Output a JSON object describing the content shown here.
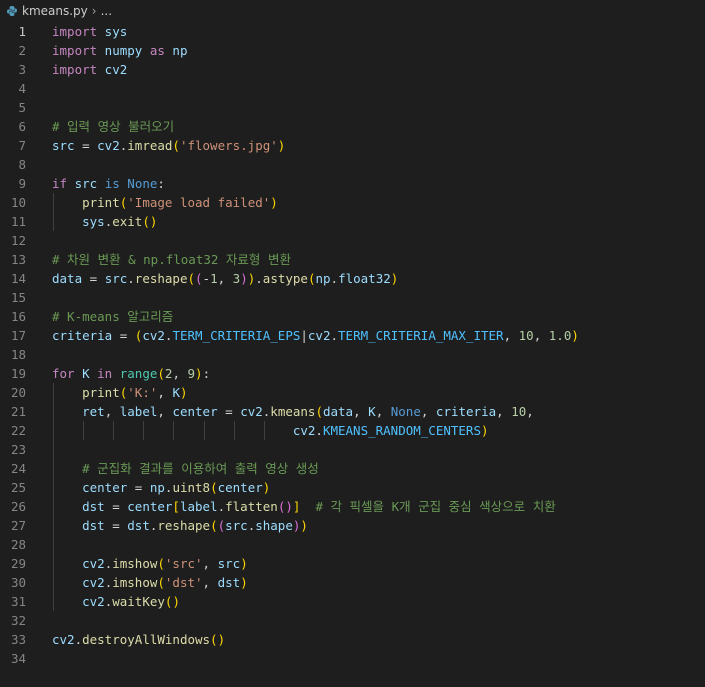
{
  "breadcrumb": {
    "file": "kmeans.py",
    "ellipsis": "..."
  },
  "editor": {
    "active_line": 1,
    "lines": [
      {
        "num": "1",
        "indent": [],
        "tokens": [
          {
            "t": "import",
            "c": "kw"
          },
          {
            "t": " sys",
            "c": "var"
          }
        ]
      },
      {
        "num": "2",
        "indent": [],
        "tokens": [
          {
            "t": "import",
            "c": "kw"
          },
          {
            "t": " numpy ",
            "c": "var"
          },
          {
            "t": "as",
            "c": "kw"
          },
          {
            "t": " np",
            "c": "var"
          }
        ]
      },
      {
        "num": "3",
        "indent": [],
        "tokens": [
          {
            "t": "import",
            "c": "kw"
          },
          {
            "t": " cv2",
            "c": "var"
          }
        ]
      },
      {
        "num": "4",
        "indent": [],
        "tokens": []
      },
      {
        "num": "5",
        "indent": [],
        "tokens": []
      },
      {
        "num": "6",
        "indent": [],
        "tokens": [
          {
            "t": "# 입력 영상 불러오기",
            "c": "cmt"
          }
        ]
      },
      {
        "num": "7",
        "indent": [],
        "tokens": [
          {
            "t": "src",
            "c": "var"
          },
          {
            "t": " = ",
            "c": "op"
          },
          {
            "t": "cv2",
            "c": "var"
          },
          {
            "t": ".",
            "c": "op"
          },
          {
            "t": "imread",
            "c": "fn"
          },
          {
            "t": "(",
            "c": "b1"
          },
          {
            "t": "'flowers.jpg'",
            "c": "str"
          },
          {
            "t": ")",
            "c": "b1"
          }
        ]
      },
      {
        "num": "8",
        "indent": [],
        "tokens": []
      },
      {
        "num": "9",
        "indent": [],
        "tokens": [
          {
            "t": "if",
            "c": "kw"
          },
          {
            "t": " src ",
            "c": "var"
          },
          {
            "t": "is",
            "c": "blue"
          },
          {
            "t": " ",
            "c": "op"
          },
          {
            "t": "None",
            "c": "blue"
          },
          {
            "t": ":",
            "c": "op"
          }
        ]
      },
      {
        "num": "10",
        "indent": [
          1
        ],
        "tokens": [
          {
            "t": "    ",
            "c": "op"
          },
          {
            "t": "print",
            "c": "fn"
          },
          {
            "t": "(",
            "c": "b1"
          },
          {
            "t": "'Image load failed'",
            "c": "str"
          },
          {
            "t": ")",
            "c": "b1"
          }
        ]
      },
      {
        "num": "11",
        "indent": [
          1
        ],
        "tokens": [
          {
            "t": "    ",
            "c": "op"
          },
          {
            "t": "sys",
            "c": "var"
          },
          {
            "t": ".",
            "c": "op"
          },
          {
            "t": "exit",
            "c": "fn"
          },
          {
            "t": "(",
            "c": "b1"
          },
          {
            "t": ")",
            "c": "b1"
          }
        ]
      },
      {
        "num": "12",
        "indent": [],
        "tokens": []
      },
      {
        "num": "13",
        "indent": [],
        "tokens": [
          {
            "t": "# 차원 변환 & np.float32 자료형 변환",
            "c": "cmt"
          }
        ]
      },
      {
        "num": "14",
        "indent": [],
        "tokens": [
          {
            "t": "data",
            "c": "var"
          },
          {
            "t": " = ",
            "c": "op"
          },
          {
            "t": "src",
            "c": "var"
          },
          {
            "t": ".",
            "c": "op"
          },
          {
            "t": "reshape",
            "c": "fn"
          },
          {
            "t": "(",
            "c": "b1"
          },
          {
            "t": "(",
            "c": "b2"
          },
          {
            "t": "-",
            "c": "op"
          },
          {
            "t": "1",
            "c": "num"
          },
          {
            "t": ", ",
            "c": "op"
          },
          {
            "t": "3",
            "c": "num"
          },
          {
            "t": ")",
            "c": "b2"
          },
          {
            "t": ")",
            "c": "b1"
          },
          {
            "t": ".",
            "c": "op"
          },
          {
            "t": "astype",
            "c": "fn"
          },
          {
            "t": "(",
            "c": "b1"
          },
          {
            "t": "np",
            "c": "var"
          },
          {
            "t": ".",
            "c": "op"
          },
          {
            "t": "float32",
            "c": "var"
          },
          {
            "t": ")",
            "c": "b1"
          }
        ]
      },
      {
        "num": "15",
        "indent": [],
        "tokens": []
      },
      {
        "num": "16",
        "indent": [],
        "tokens": [
          {
            "t": "# K-means 알고리즘",
            "c": "cmt"
          }
        ]
      },
      {
        "num": "17",
        "indent": [],
        "tokens": [
          {
            "t": "criteria",
            "c": "var"
          },
          {
            "t": " = ",
            "c": "op"
          },
          {
            "t": "(",
            "c": "b1"
          },
          {
            "t": "cv2",
            "c": "var"
          },
          {
            "t": ".",
            "c": "op"
          },
          {
            "t": "TERM_CRITERIA_EPS",
            "c": "const"
          },
          {
            "t": "|",
            "c": "op"
          },
          {
            "t": "cv2",
            "c": "var"
          },
          {
            "t": ".",
            "c": "op"
          },
          {
            "t": "TERM_CRITERIA_MAX_ITER",
            "c": "const"
          },
          {
            "t": ", ",
            "c": "op"
          },
          {
            "t": "10",
            "c": "num"
          },
          {
            "t": ", ",
            "c": "op"
          },
          {
            "t": "1.0",
            "c": "num"
          },
          {
            "t": ")",
            "c": "b1"
          }
        ]
      },
      {
        "num": "18",
        "indent": [],
        "tokens": []
      },
      {
        "num": "19",
        "indent": [],
        "tokens": [
          {
            "t": "for",
            "c": "kw"
          },
          {
            "t": " K ",
            "c": "var"
          },
          {
            "t": "in",
            "c": "kw"
          },
          {
            "t": " ",
            "c": "op"
          },
          {
            "t": "range",
            "c": "cls"
          },
          {
            "t": "(",
            "c": "b1"
          },
          {
            "t": "2",
            "c": "num"
          },
          {
            "t": ", ",
            "c": "op"
          },
          {
            "t": "9",
            "c": "num"
          },
          {
            "t": ")",
            "c": "b1"
          },
          {
            "t": ":",
            "c": "op"
          }
        ]
      },
      {
        "num": "20",
        "indent": [
          1
        ],
        "tokens": [
          {
            "t": "    ",
            "c": "op"
          },
          {
            "t": "print",
            "c": "fn"
          },
          {
            "t": "(",
            "c": "b1"
          },
          {
            "t": "'K:'",
            "c": "str"
          },
          {
            "t": ", ",
            "c": "op"
          },
          {
            "t": "K",
            "c": "var"
          },
          {
            "t": ")",
            "c": "b1"
          }
        ]
      },
      {
        "num": "21",
        "indent": [
          1
        ],
        "tokens": [
          {
            "t": "    ",
            "c": "op"
          },
          {
            "t": "ret",
            "c": "var"
          },
          {
            "t": ", ",
            "c": "op"
          },
          {
            "t": "label",
            "c": "var"
          },
          {
            "t": ", ",
            "c": "op"
          },
          {
            "t": "center",
            "c": "var"
          },
          {
            "t": " = ",
            "c": "op"
          },
          {
            "t": "cv2",
            "c": "var"
          },
          {
            "t": ".",
            "c": "op"
          },
          {
            "t": "kmeans",
            "c": "fn"
          },
          {
            "t": "(",
            "c": "b1"
          },
          {
            "t": "data",
            "c": "var"
          },
          {
            "t": ", ",
            "c": "op"
          },
          {
            "t": "K",
            "c": "var"
          },
          {
            "t": ", ",
            "c": "op"
          },
          {
            "t": "None",
            "c": "blue"
          },
          {
            "t": ", ",
            "c": "op"
          },
          {
            "t": "criteria",
            "c": "var"
          },
          {
            "t": ", ",
            "c": "op"
          },
          {
            "t": "10",
            "c": "num"
          },
          {
            "t": ",",
            "c": "op"
          }
        ]
      },
      {
        "num": "22",
        "indent": [
          1,
          2,
          3,
          4,
          5,
          6,
          7,
          8
        ],
        "tokens": [
          {
            "t": "                                ",
            "c": "op"
          },
          {
            "t": "cv2",
            "c": "var"
          },
          {
            "t": ".",
            "c": "op"
          },
          {
            "t": "KMEANS_RANDOM_CENTERS",
            "c": "const"
          },
          {
            "t": ")",
            "c": "b1"
          }
        ]
      },
      {
        "num": "23",
        "indent": [
          1
        ],
        "tokens": []
      },
      {
        "num": "24",
        "indent": [
          1
        ],
        "tokens": [
          {
            "t": "    ",
            "c": "op"
          },
          {
            "t": "# 군집화 결과를 이용하여 출력 영상 생성",
            "c": "cmt"
          }
        ]
      },
      {
        "num": "25",
        "indent": [
          1
        ],
        "tokens": [
          {
            "t": "    ",
            "c": "op"
          },
          {
            "t": "center",
            "c": "var"
          },
          {
            "t": " = ",
            "c": "op"
          },
          {
            "t": "np",
            "c": "var"
          },
          {
            "t": ".",
            "c": "op"
          },
          {
            "t": "uint8",
            "c": "fn"
          },
          {
            "t": "(",
            "c": "b1"
          },
          {
            "t": "center",
            "c": "var"
          },
          {
            "t": ")",
            "c": "b1"
          }
        ]
      },
      {
        "num": "26",
        "indent": [
          1
        ],
        "tokens": [
          {
            "t": "    ",
            "c": "op"
          },
          {
            "t": "dst",
            "c": "var"
          },
          {
            "t": " = ",
            "c": "op"
          },
          {
            "t": "center",
            "c": "var"
          },
          {
            "t": "[",
            "c": "b1"
          },
          {
            "t": "label",
            "c": "var"
          },
          {
            "t": ".",
            "c": "op"
          },
          {
            "t": "flatten",
            "c": "fn"
          },
          {
            "t": "(",
            "c": "b2"
          },
          {
            "t": ")",
            "c": "b2"
          },
          {
            "t": "]",
            "c": "b1"
          },
          {
            "t": "  ",
            "c": "op"
          },
          {
            "t": "# 각 픽셀을 K개 군집 중심 색상으로 치환",
            "c": "cmt"
          }
        ]
      },
      {
        "num": "27",
        "indent": [
          1
        ],
        "tokens": [
          {
            "t": "    ",
            "c": "op"
          },
          {
            "t": "dst",
            "c": "var"
          },
          {
            "t": " = ",
            "c": "op"
          },
          {
            "t": "dst",
            "c": "var"
          },
          {
            "t": ".",
            "c": "op"
          },
          {
            "t": "reshape",
            "c": "fn"
          },
          {
            "t": "(",
            "c": "b1"
          },
          {
            "t": "(",
            "c": "b2"
          },
          {
            "t": "src",
            "c": "var"
          },
          {
            "t": ".",
            "c": "op"
          },
          {
            "t": "shape",
            "c": "var"
          },
          {
            "t": ")",
            "c": "b2"
          },
          {
            "t": ")",
            "c": "b1"
          }
        ]
      },
      {
        "num": "28",
        "indent": [
          1
        ],
        "tokens": []
      },
      {
        "num": "29",
        "indent": [
          1
        ],
        "tokens": [
          {
            "t": "    ",
            "c": "op"
          },
          {
            "t": "cv2",
            "c": "var"
          },
          {
            "t": ".",
            "c": "op"
          },
          {
            "t": "imshow",
            "c": "fn"
          },
          {
            "t": "(",
            "c": "b1"
          },
          {
            "t": "'src'",
            "c": "str"
          },
          {
            "t": ", ",
            "c": "op"
          },
          {
            "t": "src",
            "c": "var"
          },
          {
            "t": ")",
            "c": "b1"
          }
        ]
      },
      {
        "num": "30",
        "indent": [
          1
        ],
        "tokens": [
          {
            "t": "    ",
            "c": "op"
          },
          {
            "t": "cv2",
            "c": "var"
          },
          {
            "t": ".",
            "c": "op"
          },
          {
            "t": "imshow",
            "c": "fn"
          },
          {
            "t": "(",
            "c": "b1"
          },
          {
            "t": "'dst'",
            "c": "str"
          },
          {
            "t": ", ",
            "c": "op"
          },
          {
            "t": "dst",
            "c": "var"
          },
          {
            "t": ")",
            "c": "b1"
          }
        ]
      },
      {
        "num": "31",
        "indent": [
          1
        ],
        "tokens": [
          {
            "t": "    ",
            "c": "op"
          },
          {
            "t": "cv2",
            "c": "var"
          },
          {
            "t": ".",
            "c": "op"
          },
          {
            "t": "waitKey",
            "c": "fn"
          },
          {
            "t": "(",
            "c": "b1"
          },
          {
            "t": ")",
            "c": "b1"
          }
        ]
      },
      {
        "num": "32",
        "indent": [],
        "tokens": []
      },
      {
        "num": "33",
        "indent": [],
        "tokens": [
          {
            "t": "cv2",
            "c": "var"
          },
          {
            "t": ".",
            "c": "op"
          },
          {
            "t": "destroyAllWindows",
            "c": "fn"
          },
          {
            "t": "(",
            "c": "b1"
          },
          {
            "t": ")",
            "c": "b1"
          }
        ]
      },
      {
        "num": "34",
        "indent": [],
        "tokens": []
      }
    ]
  },
  "theme": {
    "background": "#1e1e1e",
    "line_number": "#858585",
    "line_number_active": "#c6c6c6",
    "file_icon": "#519aba"
  }
}
